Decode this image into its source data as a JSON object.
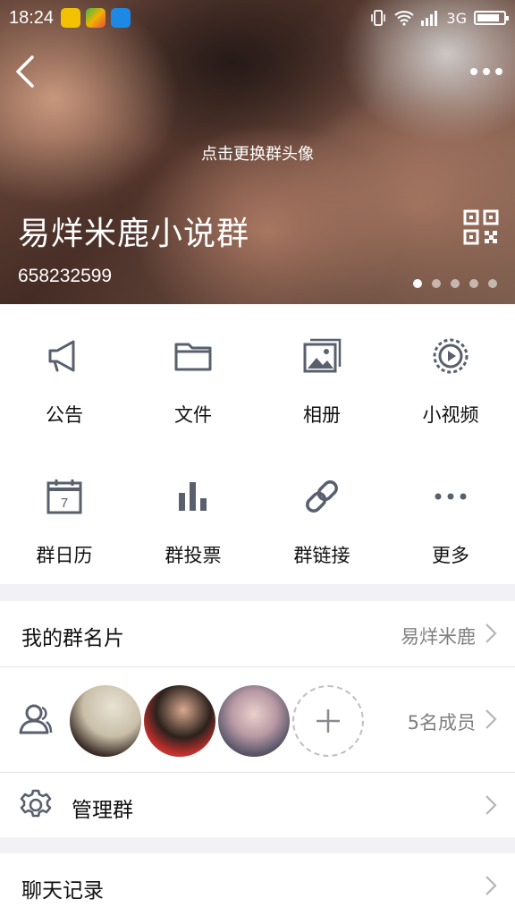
{
  "status_bar": {
    "time": "18:24",
    "network": "3G",
    "battery_level": 0.85
  },
  "header": {
    "change_avatar_hint": "点击更换群头像",
    "group_name": "易烊米鹿小说群",
    "group_id": "658232599",
    "photo_pages": 5,
    "active_page": 1
  },
  "features": [
    {
      "label": "公告",
      "icon": "megaphone-icon"
    },
    {
      "label": "文件",
      "icon": "folder-icon"
    },
    {
      "label": "相册",
      "icon": "album-icon"
    },
    {
      "label": "小视频",
      "icon": "video-icon"
    },
    {
      "label": "群日历",
      "icon": "calendar-icon",
      "calendar_day": "7"
    },
    {
      "label": "群投票",
      "icon": "vote-chart-icon"
    },
    {
      "label": "群链接",
      "icon": "link-icon"
    },
    {
      "label": "更多",
      "icon": "more-icon"
    }
  ],
  "my_card": {
    "label": "我的群名片",
    "value": "易烊米鹿"
  },
  "members": {
    "count_label": "5名成员",
    "icon": "members-icon"
  },
  "manage": {
    "label": "管理群",
    "icon": "gear-icon"
  },
  "chat_history": {
    "label": "聊天记录"
  },
  "colors": {
    "icon_gray": "#5a5f6e",
    "divider": "#e3e3e6",
    "section_bg": "#f2f2f4"
  }
}
